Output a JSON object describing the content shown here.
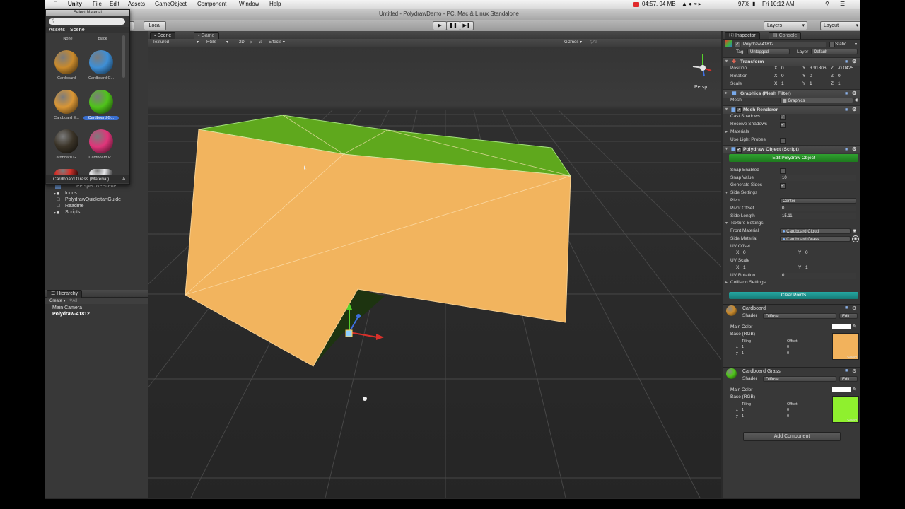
{
  "menubar": {
    "app": "Unity",
    "items": [
      "File",
      "Edit",
      "Assets",
      "GameObject",
      "Component",
      "Window",
      "Help"
    ],
    "status": "04:57, 94 MB",
    "battery": "97%",
    "clock": "Fri 10:12 AM"
  },
  "window_title": "Untitled - PolydrawDemo - PC, Mac & Linux Standalone",
  "toolbar": {
    "layers": "Layers",
    "layout": "Layout",
    "pivot_label": "ot",
    "local_label": "Local"
  },
  "select_material": {
    "title": "Select Material",
    "search_placeholder": "",
    "tabs": [
      "Assets",
      "Scene"
    ],
    "materials": [
      {
        "name": "None",
        "color": ""
      },
      {
        "name": "black",
        "color": ""
      },
      {
        "name": "Cardboard",
        "color": "#c98a2c"
      },
      {
        "name": "Cardboard C...",
        "color": "#3e8fd6"
      },
      {
        "name": "Cardboard E...",
        "color": "#d99635"
      },
      {
        "name": "Cardboard G...",
        "color": "#4fc41a"
      },
      {
        "name": "Cardboard G...",
        "color": "#3a3327"
      },
      {
        "name": "Cardboard P...",
        "color": "#e0357a"
      },
      {
        "name": "",
        "color": "#d6332c"
      },
      {
        "name": "",
        "color": "#e8e8ea"
      }
    ],
    "footer": "Cardboard Grass (Material)",
    "footer_right": "A"
  },
  "project": {
    "items": [
      "PerspectiveScene",
      "Icons",
      "PolydrawQuickstartGuide",
      "Readme",
      "Scripts"
    ]
  },
  "hierarchy": {
    "title": "Hierarchy",
    "create": "Create",
    "search": "All",
    "items": [
      "Main Camera",
      "Polydraw-41812"
    ]
  },
  "scene": {
    "tab_scene": "Scene",
    "tab_game": "Game",
    "render_mode": "Textured",
    "color_mode": "RGB",
    "two_d": "2D",
    "effects": "Effects",
    "gizmos": "Gizmos",
    "search": "All",
    "persp": "Persp"
  },
  "inspector": {
    "tab_inspector": "Inspector",
    "tab_console": "Console",
    "object_name": "Polydraw-41812",
    "static_label": "Static",
    "tag_label": "Tag",
    "tag_value": "Untagged",
    "layer_label": "Layer",
    "layer_value": "Default",
    "transform": {
      "title": "Transform",
      "rows": [
        {
          "label": "Position",
          "x": "0",
          "y": "3.91806",
          "z": "-0.0425"
        },
        {
          "label": "Rotation",
          "x": "0",
          "y": "0",
          "z": "0"
        },
        {
          "label": "Scale",
          "x": "1",
          "y": "1",
          "z": "1"
        }
      ]
    },
    "mesh_filter": {
      "title": "Graphics (Mesh Filter)",
      "mesh_label": "Mesh",
      "mesh_value": "Graphics"
    },
    "mesh_renderer": {
      "title": "Mesh Renderer",
      "cast_shadows": "Cast Shadows",
      "receive_shadows": "Receive Shadows",
      "materials": "Materials",
      "use_light_probes": "Use Light Probes"
    },
    "polydraw": {
      "title": "Polydraw Object (Script)",
      "edit_button": "Edit Polydraw Object",
      "snap_enabled": "Snap Enabled",
      "snap_value_label": "Snap Value",
      "snap_value": "10",
      "generate_sides": "Generate Sides",
      "side_settings": "Side Settings",
      "pivot_label": "Pivot",
      "pivot_value": "Center",
      "pivot_offset_label": "Pivot Offset",
      "pivot_offset": "0",
      "side_length_label": "Side Length",
      "side_length": "15.11",
      "texture_settings": "Texture Settings",
      "front_material_label": "Front Material",
      "front_material": "Cardboard Cloud",
      "side_material_label": "Side Material",
      "side_material": "Cardboard Grass",
      "uv_offset": "UV Offset",
      "uv_offset_x": "0",
      "uv_offset_y": "0",
      "uv_scale": "UV Scale",
      "uv_scale_x": "1",
      "uv_scale_y": "1",
      "uv_rotation_label": "UV Rotation",
      "uv_rotation": "0",
      "collision_settings": "Collision Settings",
      "clear_points": "Clear Points"
    },
    "materials": [
      {
        "name": "Cardboard",
        "shader_label": "Shader",
        "shader": "Diffuse",
        "edit": "Edit...",
        "main_color": "Main Color",
        "base": "Base (RGB)",
        "tiling": "Tiling",
        "offset": "Offset",
        "tx": "1",
        "ty": "1",
        "ox": "0",
        "oy": "0",
        "select": "Select",
        "swatch": "#f2b25c",
        "sphere": "#c98a2c"
      },
      {
        "name": "Cardboard Grass",
        "shader_label": "Shader",
        "shader": "Diffuse",
        "edit": "Edit...",
        "main_color": "Main Color",
        "base": "Base (RGB)",
        "tiling": "Tiling",
        "offset": "Offset",
        "tx": "1",
        "ty": "1",
        "ox": "0",
        "oy": "0",
        "select": "Select",
        "swatch": "#8ff02e",
        "sphere": "#4fc41a"
      }
    ],
    "add_component": "Add Component"
  },
  "colors": {
    "accent_green": "#2e8c2e",
    "accent_teal": "#1f8f8a",
    "box_front": "#f2b45e",
    "box_top": "#5fa81d",
    "box_under": "#1e3a10"
  }
}
